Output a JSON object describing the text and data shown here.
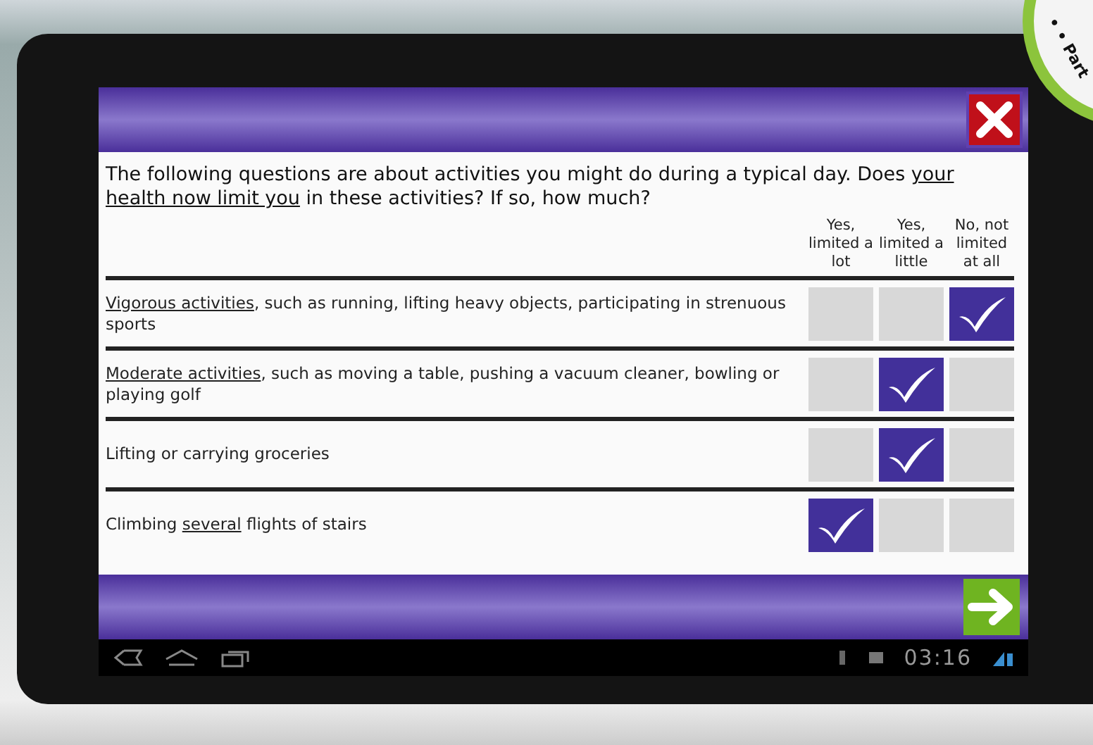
{
  "badge": {
    "text": "• • Part"
  },
  "intro": [
    {
      "text": "The following questions are about activities you might do during a typical day. Does ",
      "underlined": false
    },
    {
      "text": "your health now limit you",
      "underlined": true
    },
    {
      "text": " in these activities? If so, how much?",
      "underlined": false
    }
  ],
  "columns": [
    "Yes, limited a lot",
    "Yes, limited a little",
    "No, not limited at all"
  ],
  "questions": [
    {
      "segments": [
        {
          "text": "Vigorous activities",
          "underlined": true
        },
        {
          "text": ", such as running, lifting heavy objects, participating in strenuous sports",
          "underlined": false
        }
      ],
      "answers": [
        {
          "selected": false
        },
        {
          "selected": false
        },
        {
          "selected": true
        }
      ]
    },
    {
      "segments": [
        {
          "text": "Moderate activities",
          "underlined": true
        },
        {
          "text": ", such as moving a table, pushing a vacuum cleaner, bowling or playing golf",
          "underlined": false
        }
      ],
      "answers": [
        {
          "selected": false
        },
        {
          "selected": true
        },
        {
          "selected": false
        }
      ]
    },
    {
      "segments": [
        {
          "text": "Lifting or carrying groceries",
          "underlined": false
        }
      ],
      "answers": [
        {
          "selected": false
        },
        {
          "selected": true
        },
        {
          "selected": false
        }
      ]
    },
    {
      "segments": [
        {
          "text": "Climbing ",
          "underlined": false
        },
        {
          "text": "several",
          "underlined": true
        },
        {
          "text": " flights of stairs",
          "underlined": false
        }
      ],
      "answers": [
        {
          "selected": true
        },
        {
          "selected": false
        },
        {
          "selected": false
        }
      ]
    }
  ],
  "status_bar": {
    "time": "03:16"
  }
}
